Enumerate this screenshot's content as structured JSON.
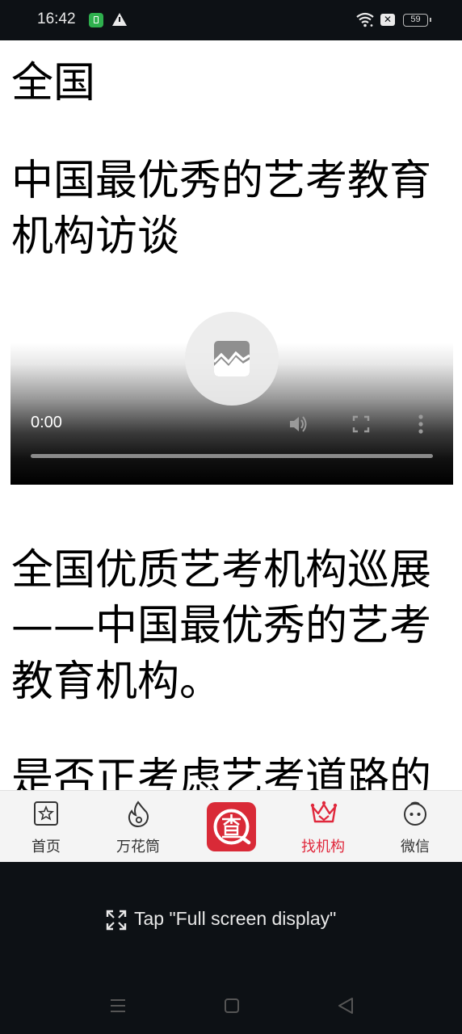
{
  "status_bar": {
    "time": "16:42",
    "battery": "59",
    "icons": [
      "notification-app-icon",
      "warning-icon",
      "wifi-icon",
      "xbox-icon",
      "battery-icon"
    ]
  },
  "content": {
    "region": "全国",
    "title": "中国最优秀的艺考教育机构访谈",
    "exhibition": "全国优质艺考机构巡展——中国最优秀的艺考教育机构。",
    "question_partial": "是否正考虑艺考道路的"
  },
  "video": {
    "time": "0:00",
    "icons": [
      "broken-video-icon",
      "volume-icon",
      "fullscreen-icon",
      "more-options-icon"
    ]
  },
  "tabbar": {
    "tabs": [
      {
        "label": "首页",
        "icon": "home-star-icon",
        "active": false
      },
      {
        "label": "万花筒",
        "icon": "flame-icon",
        "active": false
      },
      {
        "label": "",
        "icon": "cha-logo-icon",
        "active": false
      },
      {
        "label": "找机构",
        "icon": "crown-icon",
        "active": true
      },
      {
        "label": "微信",
        "icon": "face-icon",
        "active": false
      }
    ]
  },
  "overlay_hint": {
    "text": "Tap \"Full screen display\""
  },
  "navbar": {
    "icons": [
      "menu-icon",
      "home-square-icon",
      "back-triangle-icon"
    ]
  },
  "colors": {
    "accent": "#e0283c",
    "logo_red": "#d92a37",
    "dark_bg": "#0d1115"
  }
}
